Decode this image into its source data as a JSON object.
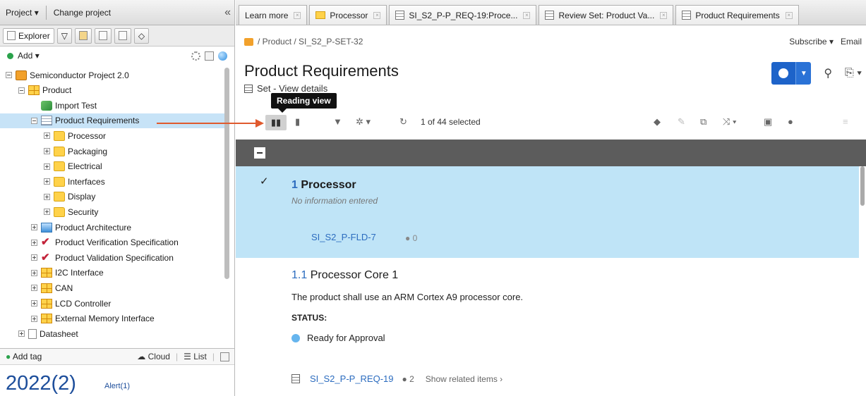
{
  "left": {
    "project_menu": "Project",
    "change_project": "Change project",
    "explorer_tab": "Explorer",
    "add": "Add",
    "tree": [
      {
        "label": "Semiconductor Project 2.0",
        "indent": 0,
        "icon": "project-icon",
        "toggle": "minus"
      },
      {
        "label": "Product",
        "indent": 1,
        "icon": "grid-folder-icon",
        "toggle": "minus"
      },
      {
        "label": "Import Test",
        "indent": 2,
        "icon": "import-icon",
        "toggle": ""
      },
      {
        "label": "Product Requirements",
        "indent": 2,
        "icon": "set-icon",
        "toggle": "minus",
        "selected": true
      },
      {
        "label": "Processor",
        "indent": 3,
        "icon": "folder-icon",
        "toggle": "plus"
      },
      {
        "label": "Packaging",
        "indent": 3,
        "icon": "folder-icon",
        "toggle": "plus"
      },
      {
        "label": "Electrical",
        "indent": 3,
        "icon": "folder-icon",
        "toggle": "plus"
      },
      {
        "label": "Interfaces",
        "indent": 3,
        "icon": "folder-icon",
        "toggle": "plus"
      },
      {
        "label": "Display",
        "indent": 3,
        "icon": "folder-icon",
        "toggle": "plus"
      },
      {
        "label": "Security",
        "indent": 3,
        "icon": "folder-icon",
        "toggle": "plus"
      },
      {
        "label": "Product Architecture",
        "indent": 2,
        "icon": "diagram-icon",
        "toggle": "plus"
      },
      {
        "label": "Product Verification Specification",
        "indent": 2,
        "icon": "check-icon",
        "toggle": "plus"
      },
      {
        "label": "Product Validation Specification",
        "indent": 2,
        "icon": "check-icon",
        "toggle": "plus"
      },
      {
        "label": "I2C Interface",
        "indent": 2,
        "icon": "grid-folder-icon",
        "toggle": "plus"
      },
      {
        "label": "CAN",
        "indent": 2,
        "icon": "grid-folder-icon",
        "toggle": "plus"
      },
      {
        "label": "LCD Controller",
        "indent": 2,
        "icon": "grid-folder-icon",
        "toggle": "plus"
      },
      {
        "label": "External Memory Interface",
        "indent": 2,
        "icon": "grid-folder-icon",
        "toggle": "plus"
      },
      {
        "label": "Datasheet",
        "indent": 1,
        "icon": "sheet-icon",
        "toggle": "plus"
      }
    ],
    "add_tag": "Add tag",
    "cloud": "Cloud",
    "list": "List",
    "year": "2022(2)",
    "alert": "Alert(1)"
  },
  "tabs": [
    {
      "label": "Learn more",
      "icon": ""
    },
    {
      "label": "Processor",
      "icon": "folder"
    },
    {
      "label": "SI_S2_P-P_REQ-19:Proce...",
      "icon": "doc"
    },
    {
      "label": "Review Set: Product Va...",
      "icon": "doc"
    },
    {
      "label": "Product Requirements",
      "icon": "doc"
    }
  ],
  "breadcrumb": "/ Product / SI_S2_P-SET-32",
  "subscribe": "Subscribe",
  "email": "Email",
  "page_title": "Product Requirements",
  "set_line": "Set - View details",
  "tooltip": "Reading view",
  "selection": "1 of 44 selected",
  "items": {
    "first": {
      "number": "1",
      "title": "Processor",
      "no_info": "No information entered",
      "id": "SI_S2_P-FLD-7",
      "comments": "0"
    },
    "second": {
      "number": "1.1",
      "title": "Processor Core 1",
      "description": "The product shall use an ARM Cortex A9 processor core.",
      "status_label": "STATUS:",
      "status_value": "Ready for Approval",
      "id": "SI_S2_P-P_REQ-19",
      "comments": "2",
      "related": "Show related items"
    }
  },
  "colors": {
    "accent_blue": "#1d63c9",
    "selected_row": "#bfe4f7",
    "annotation_arrow": "#e05a2e"
  }
}
